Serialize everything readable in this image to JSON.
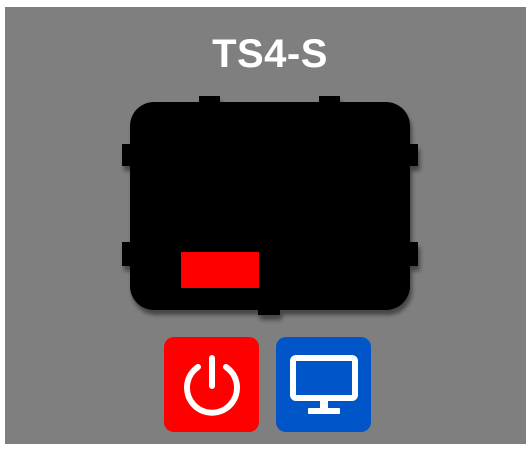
{
  "device": {
    "model": "TS4-S",
    "body_color": "#000000",
    "indicator_color": "#ff0000",
    "background_color": "#7f7f7f"
  },
  "controls": {
    "power": {
      "icon": "power-icon",
      "color": "#ff0000"
    },
    "display": {
      "icon": "monitor-icon",
      "color": "#0055c8"
    }
  }
}
